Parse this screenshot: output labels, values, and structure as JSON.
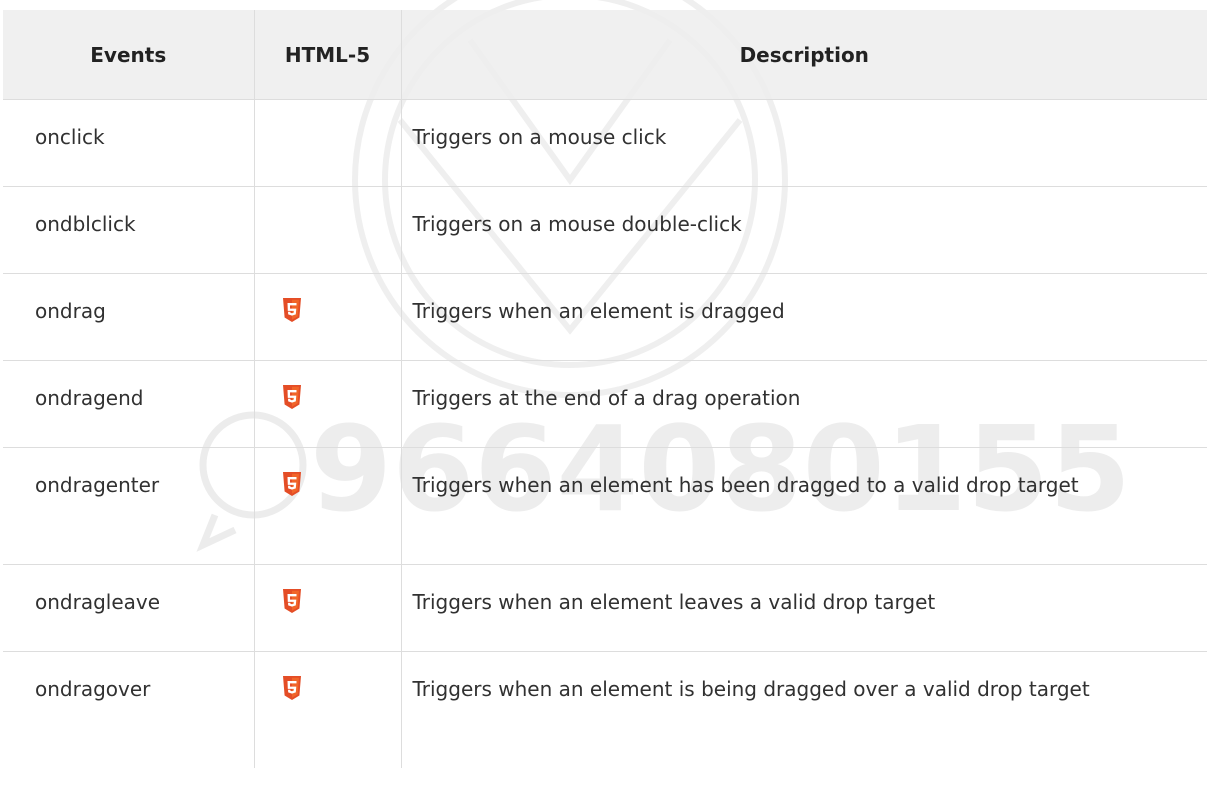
{
  "table": {
    "headers": {
      "events": "Events",
      "html5": "HTML-5",
      "description": "Description"
    },
    "rows": [
      {
        "event": "onclick",
        "html5": false,
        "description": "Triggers on a mouse click"
      },
      {
        "event": "ondblclick",
        "html5": false,
        "description": "Triggers on a mouse double-click"
      },
      {
        "event": "ondrag",
        "html5": true,
        "description": "Triggers when an element is dragged"
      },
      {
        "event": "ondragend",
        "html5": true,
        "description": "Triggers at the end of a drag operation"
      },
      {
        "event": "ondragenter",
        "html5": true,
        "description": "Triggers when an element has been dragged to a valid drop target"
      },
      {
        "event": "ondragleave",
        "html5": true,
        "description": "Triggers when an element leaves a valid drop target"
      },
      {
        "event": "ondragover",
        "html5": true,
        "description": "Triggers when an element is being dragged over a valid drop target"
      }
    ]
  },
  "icons": {
    "html5_badge": "html5-shield-icon",
    "watermark_contact": "whatsapp-icon"
  },
  "watermark": {
    "phone": "9664080155"
  },
  "colors": {
    "html5_orange": "#e44d26",
    "header_bg": "#eeeeee",
    "border": "#dddddd",
    "text": "#313131"
  }
}
